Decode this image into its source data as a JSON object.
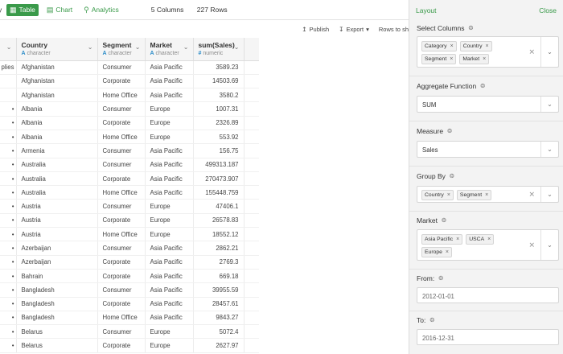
{
  "topbar": {
    "clipped_char": "y",
    "tabs": [
      {
        "label": "Table",
        "icon": "table-icon",
        "active": true
      },
      {
        "label": "Chart",
        "icon": "chart-icon",
        "active": false
      },
      {
        "label": "Analytics",
        "icon": "lightbulb-icon",
        "active": false
      }
    ],
    "columns_count": "5 Columns",
    "rows_count": "227 Rows"
  },
  "toolbar": {
    "publish": "Publish",
    "export": "Export",
    "rows_to": "Rows to sh"
  },
  "table": {
    "columns": [
      {
        "name": "",
        "type": ""
      },
      {
        "name": "Country",
        "type": "character"
      },
      {
        "name": "Segment",
        "type": "character"
      },
      {
        "name": "Market",
        "type": "character"
      },
      {
        "name": "sum(Sales)",
        "type": "numeric"
      }
    ],
    "rows": [
      [
        "plies",
        "Afghanistan",
        "Consumer",
        "Asia Pacific",
        "3589.23"
      ],
      [
        "",
        "Afghanistan",
        "Corporate",
        "Asia Pacific",
        "14503.69"
      ],
      [
        "",
        "Afghanistan",
        "Home Office",
        "Asia Pacific",
        "3580.2"
      ],
      [
        "•",
        "Albania",
        "Consumer",
        "Europe",
        "1007.31"
      ],
      [
        "•",
        "Albania",
        "Corporate",
        "Europe",
        "2326.89"
      ],
      [
        "•",
        "Albania",
        "Home Office",
        "Europe",
        "553.92"
      ],
      [
        "•",
        "Armenia",
        "Consumer",
        "Asia Pacific",
        "156.75"
      ],
      [
        "•",
        "Australia",
        "Consumer",
        "Asia Pacific",
        "499313.187"
      ],
      [
        "•",
        "Australia",
        "Corporate",
        "Asia Pacific",
        "270473.907"
      ],
      [
        "•",
        "Australia",
        "Home Office",
        "Asia Pacific",
        "155448.759"
      ],
      [
        "•",
        "Austria",
        "Consumer",
        "Europe",
        "47406.1"
      ],
      [
        "•",
        "Austria",
        "Corporate",
        "Europe",
        "26578.83"
      ],
      [
        "•",
        "Austria",
        "Home Office",
        "Europe",
        "18552.12"
      ],
      [
        "•",
        "Azerbaijan",
        "Consumer",
        "Asia Pacific",
        "2862.21"
      ],
      [
        "•",
        "Azerbaijan",
        "Corporate",
        "Asia Pacific",
        "2769.3"
      ],
      [
        "•",
        "Bahrain",
        "Corporate",
        "Asia Pacific",
        "669.18"
      ],
      [
        "•",
        "Bangladesh",
        "Consumer",
        "Asia Pacific",
        "39955.59"
      ],
      [
        "•",
        "Bangladesh",
        "Corporate",
        "Asia Pacific",
        "28457.61"
      ],
      [
        "•",
        "Bangladesh",
        "Home Office",
        "Asia Pacific",
        "9843.27"
      ],
      [
        "•",
        "Belarus",
        "Consumer",
        "Europe",
        "5072.4"
      ],
      [
        "•",
        "Belarus",
        "Corporate",
        "Europe",
        "2627.97"
      ]
    ]
  },
  "panel": {
    "layout": "Layout",
    "close": "Close",
    "select_columns": {
      "label": "Select Columns",
      "chips": [
        "Category",
        "Country",
        "Segment",
        "Market"
      ]
    },
    "aggregate": {
      "label": "Aggregate Function",
      "value": "SUM"
    },
    "measure": {
      "label": "Measure",
      "value": "Sales"
    },
    "group_by": {
      "label": "Group By",
      "chips": [
        "Country",
        "Segment"
      ]
    },
    "market": {
      "label": "Market",
      "chips": [
        "Asia Pacific",
        "USCA",
        "Europe"
      ]
    },
    "from": {
      "label": "From:",
      "value": "2012-01-01"
    },
    "to": {
      "label": "To:",
      "value": "2016-12-31"
    }
  },
  "colors": {
    "accent": "#3a9a4a",
    "type_icon": "#2f8ec9",
    "panel_bg": "#f3f3f3"
  }
}
